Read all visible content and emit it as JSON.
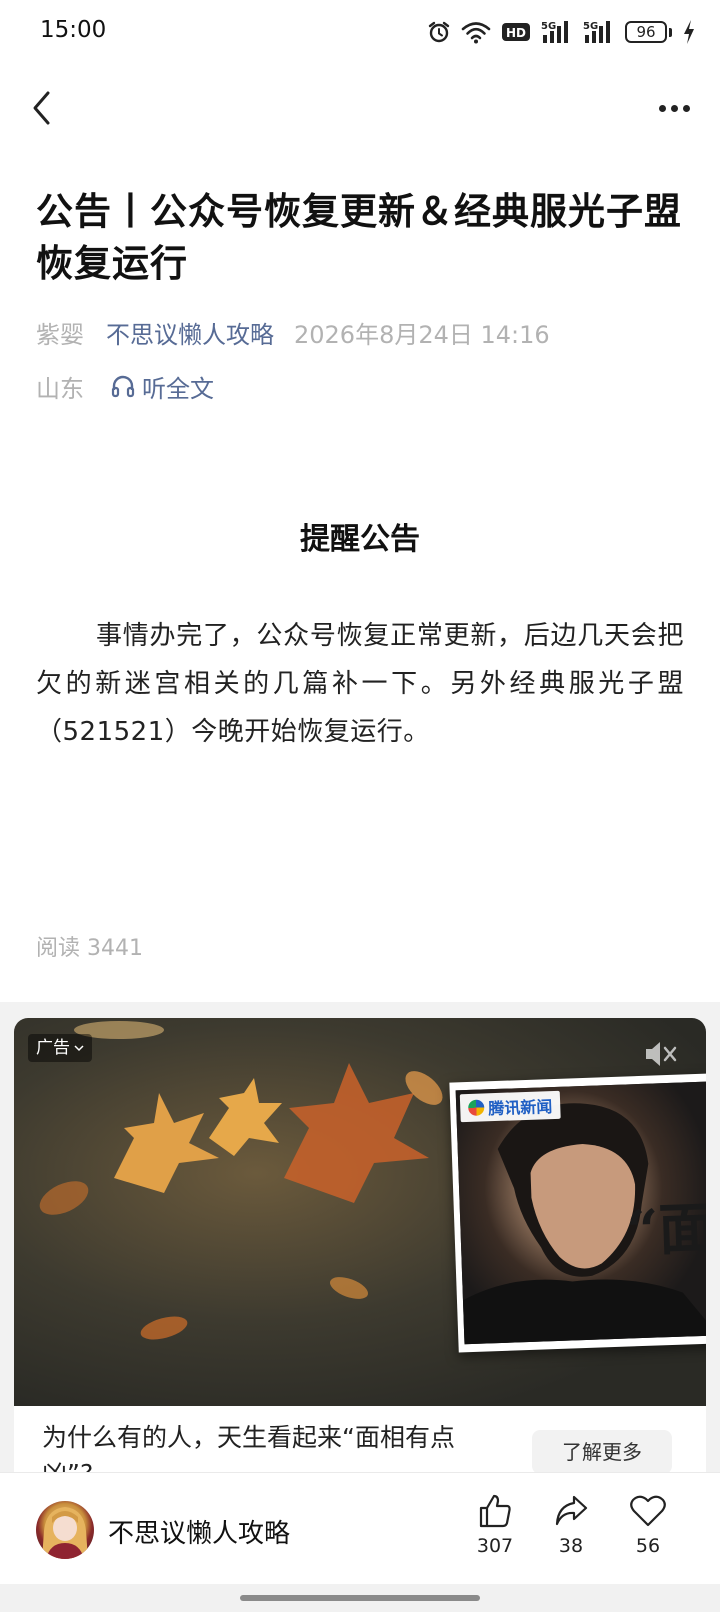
{
  "status_bar": {
    "time": "15:00",
    "network_hd": "HD",
    "signal1": "5G",
    "signal2": "5G",
    "battery": "96",
    "icons": [
      "alarm-icon",
      "wifi-icon",
      "hd-icon",
      "signal-5g-icon",
      "signal-5g-icon",
      "battery-icon",
      "charging-icon"
    ]
  },
  "nav": {
    "back_icon": "chevron-left-icon",
    "more_icon": "more-dots-icon"
  },
  "article": {
    "title": "公告丨公众号恢复更新＆经典服光子盟恢复运行",
    "author": "紫婴",
    "account": "不思议懒人攻略",
    "datetime": "2026年8月24日 14:16",
    "location": "山东",
    "listen_label": "听全文",
    "section_heading": "提醒公告",
    "body": "事情办完了，公众号恢复正常更新，后边几天会把欠的新迷宫相关的几篇补一下。另外经典服光子盟（521521）今晚开始恢复运行。",
    "read_count": "阅读 3441"
  },
  "ad": {
    "badge": "广告",
    "news_brand": "腾讯新闻",
    "news_quote": "“面",
    "caption": "为什么有的人，天生看起来“面相有点凶”?",
    "action_label": "了解更多"
  },
  "bottom_bar": {
    "account_name": "不思议懒人攻略",
    "likes": "307",
    "shares": "38",
    "favorites": "56"
  },
  "colors": {
    "link": "#576b95",
    "meta_gray": "#b2b2b2",
    "text": "#111111"
  }
}
